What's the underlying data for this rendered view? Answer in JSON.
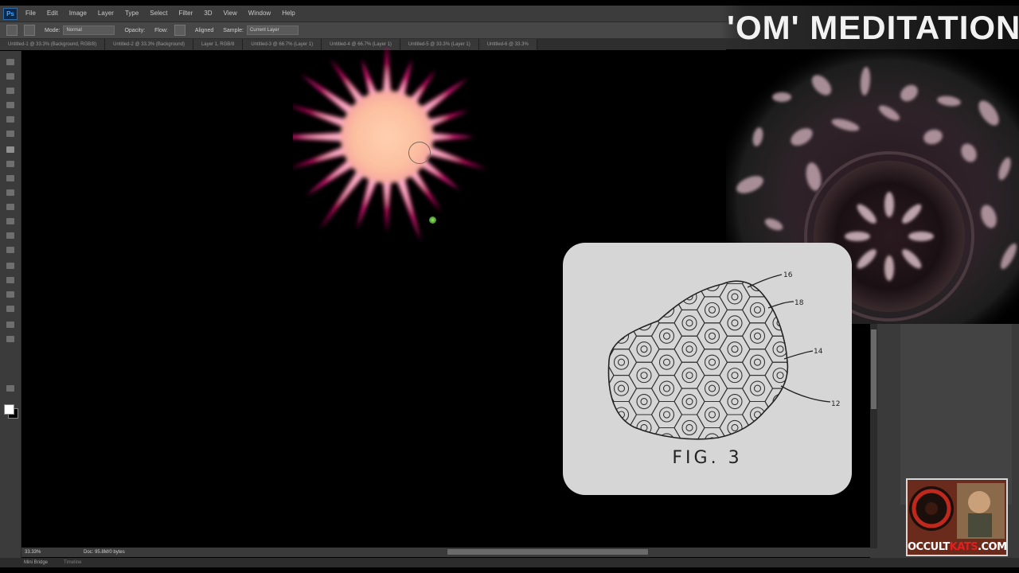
{
  "app": {
    "logo_text": "Ps"
  },
  "menu": [
    "File",
    "Edit",
    "Image",
    "Layer",
    "Type",
    "Select",
    "Filter",
    "3D",
    "View",
    "Window",
    "Help"
  ],
  "options": {
    "mode_label": "Mode:",
    "mode_value": "Normal",
    "opacity_label": "Opacity:",
    "flow_label": "Flow:",
    "aligned_label": "Aligned",
    "sample_label": "Sample:",
    "sample_value": "Current Layer"
  },
  "tabs": [
    "Untitled-1 @ 33.3% (Background, RGB/8)",
    "Untitled-2 @ 33.3% (Background)",
    "Layer 1, RGB/8",
    "Untitled-3 @ 66.7% (Layer 1)",
    "Untitled-4 @ 66.7% (Layer 1)",
    "Untitled-5 @ 33.3% (Layer 1)",
    "Untitled-6 @ 33.3%"
  ],
  "status": {
    "zoom": "33.33%",
    "doc": "Doc: 95.8M/0 bytes"
  },
  "timeline": {
    "tab1": "Mini Bridge",
    "tab2": "Timeline"
  },
  "overlay": {
    "title": "'OM' MEDITATION"
  },
  "figure": {
    "label": "FIG. 3",
    "callouts": [
      "16",
      "18",
      "14",
      "12"
    ]
  },
  "logo": {
    "text_left": "OCCULT",
    "text_red": "KATS",
    "text_right": ".COM"
  },
  "colors": {
    "ui_dark": "#3c3c3c",
    "canvas": "#000000",
    "starburst_core": "#fcc6a6",
    "starburst_spike": "#ff1a8c",
    "card_bg": "#d6d6d6",
    "logo_red": "#e02020"
  },
  "icons": [
    "photoshop-logo-icon",
    "brush-preset-icon",
    "clone-stamp-icon",
    "airbrush-icon"
  ]
}
